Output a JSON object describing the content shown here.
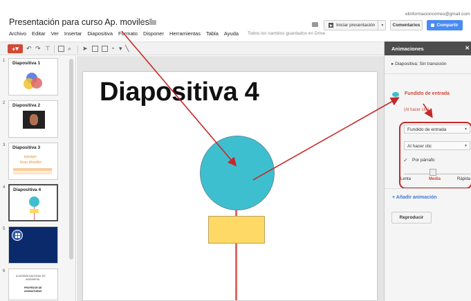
{
  "header": {
    "doc_title": "Presentación para curso Ap. moviles.",
    "user_email": "elinformacioncorreo@gmail.com",
    "menu": [
      "Archivo",
      "Editar",
      "Ver",
      "Insertar",
      "Diapositiva",
      "Formato",
      "Disponer",
      "Herramientas",
      "Tabla",
      "Ayuda"
    ],
    "save_status": "Todos los cambios guardados en Drive",
    "present_label": "Iniciar presentación",
    "comments_label": "Comentarios",
    "share_label": "Compartir"
  },
  "toolbar": {
    "new_slide_label": "+"
  },
  "filmstrip": {
    "slides": [
      {
        "number": "1",
        "title": "Diapositiva 1"
      },
      {
        "number": "2",
        "title": "Diapositiva 2"
      },
      {
        "number": "3",
        "title": "Diapositiva 3",
        "text_line1": "Ejemplo",
        "text_line2": "Texto WordArt"
      },
      {
        "number": "4",
        "title": "Diapositiva 4"
      },
      {
        "number": "5",
        "title": ""
      },
      {
        "number": "6",
        "title": "",
        "text_line1": "ACADEMIA NACIONAL DE",
        "text_line2": "INGENIERIA",
        "text_line3": "PROFESOR DE",
        "text_line4": "ASIGNATURAS"
      }
    ]
  },
  "slide": {
    "title": "Diapositiva 4",
    "colors": {
      "circle": "#3ebfd0",
      "rectangle": "#ffd966",
      "line": "#e06666"
    }
  },
  "panel": {
    "title": "Animaciones",
    "transition": "Diapositiva: Sin transición",
    "animation_name": "Fundido de entrada",
    "animation_trigger": "(Al hacer clic)",
    "effect_select": "Fundido de entrada",
    "trigger_select": "Al hacer clic",
    "by_paragraph_label": "Por párrafo",
    "speed_labels": [
      "Lenta",
      "Media",
      "Rápida"
    ],
    "speed_selected": "Media",
    "add_animation": "+ Añadir animación",
    "play_label": "Reproducir"
  },
  "colors": {
    "accent_red": "#d14836",
    "share_blue": "#4a8af4",
    "annotation_red": "#c62828"
  }
}
